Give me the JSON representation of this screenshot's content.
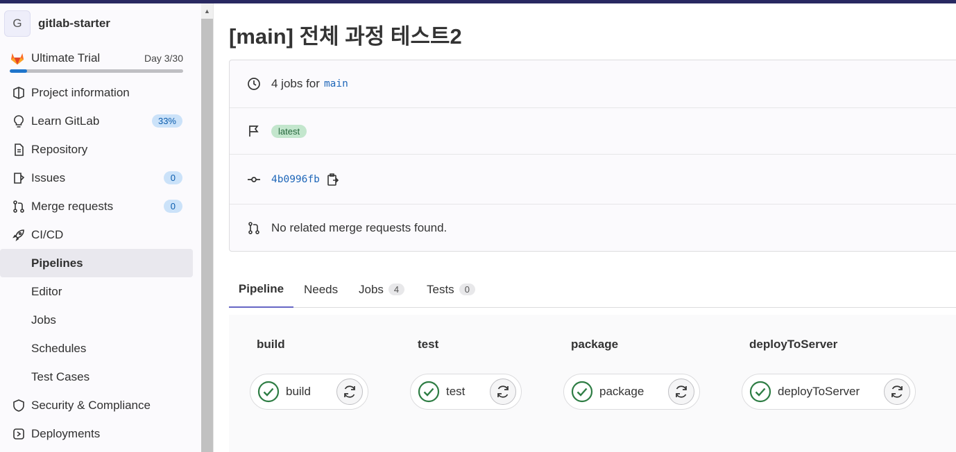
{
  "project": {
    "avatar_letter": "G",
    "name": "gitlab-starter"
  },
  "trial": {
    "title": "Ultimate Trial",
    "day": "Day 3/30",
    "progress": 0.1
  },
  "sidebar": {
    "items": [
      {
        "label": "Project information",
        "icon": "project-info-icon"
      },
      {
        "label": "Learn GitLab",
        "icon": "bulb-icon",
        "badge": "33%"
      },
      {
        "label": "Repository",
        "icon": "document-icon"
      },
      {
        "label": "Issues",
        "icon": "issues-icon",
        "badge": "0"
      },
      {
        "label": "Merge requests",
        "icon": "merge-request-icon",
        "badge": "0"
      },
      {
        "label": "CI/CD",
        "icon": "rocket-icon"
      }
    ],
    "cicd_sub": [
      "Pipelines",
      "Editor",
      "Jobs",
      "Schedules",
      "Test Cases"
    ],
    "more_items": [
      {
        "label": "Security & Compliance",
        "icon": "shield-icon"
      },
      {
        "label": "Deployments",
        "icon": "deployments-icon"
      }
    ]
  },
  "page": {
    "title": "[main] 전체 과정 테스트2"
  },
  "info": {
    "jobs_text": "4 jobs for",
    "branch": "main",
    "tag": "latest",
    "commit_sha": "4b0996fb",
    "mr_text": "No related merge requests found."
  },
  "tabs": [
    {
      "label": "Pipeline"
    },
    {
      "label": "Needs"
    },
    {
      "label": "Jobs",
      "count": "4"
    },
    {
      "label": "Tests",
      "count": "0"
    }
  ],
  "stages": [
    {
      "title": "build",
      "job": "build"
    },
    {
      "title": "test",
      "job": "test"
    },
    {
      "title": "package",
      "job": "package"
    },
    {
      "title": "deployToServer",
      "job": "deployToServer"
    }
  ]
}
